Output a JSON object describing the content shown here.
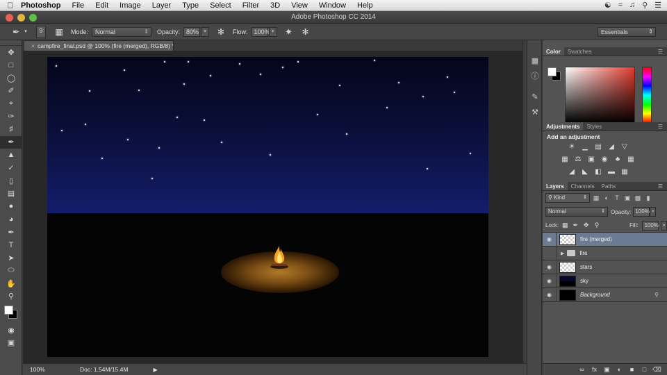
{
  "menubar": {
    "app_name": "Photoshop",
    "items": [
      "File",
      "Edit",
      "Image",
      "Layer",
      "Type",
      "Select",
      "Filter",
      "3D",
      "View",
      "Window",
      "Help"
    ]
  },
  "window": {
    "title": "Adobe Photoshop CC 2014"
  },
  "options_bar": {
    "brush_size": "9",
    "mode_label": "Mode:",
    "mode_value": "Normal",
    "opacity_label": "Opacity:",
    "opacity_value": "80%",
    "flow_label": "Flow:",
    "flow_value": "100%",
    "workspace": "Essentials"
  },
  "document": {
    "tab_title": "campfire_final.psd @ 100% (fire (merged), RGB/8) *"
  },
  "status_bar": {
    "zoom": "100%",
    "doc_info": "Doc: 1.54M/15.4M"
  },
  "color_panel": {
    "tabs": [
      "Color",
      "Swatches"
    ],
    "foreground": "#ffffff",
    "background": "#000000"
  },
  "adjustments_panel": {
    "tabs": [
      "Adjustments",
      "Styles"
    ],
    "heading": "Add an adjustment"
  },
  "layers_panel": {
    "tabs": [
      "Layers",
      "Channels",
      "Paths"
    ],
    "filter_kind": "Kind",
    "blend_mode": "Normal",
    "opacity_label": "Opacity:",
    "opacity_value": "100%",
    "lock_label": "Lock:",
    "fill_label": "Fill:",
    "fill_value": "100%",
    "layers": [
      {
        "name": "fire (merged)",
        "selected": true,
        "visible": true,
        "type": "pixel"
      },
      {
        "name": "fire",
        "selected": false,
        "visible": false,
        "type": "group"
      },
      {
        "name": "stars",
        "selected": false,
        "visible": true,
        "type": "pixel"
      },
      {
        "name": "sky",
        "selected": false,
        "visible": true,
        "type": "sky"
      },
      {
        "name": "Background",
        "selected": false,
        "visible": true,
        "type": "background",
        "locked": true
      }
    ]
  },
  "colors": {
    "selected_layer": "#6c7a92",
    "panel_bg": "#535353"
  }
}
